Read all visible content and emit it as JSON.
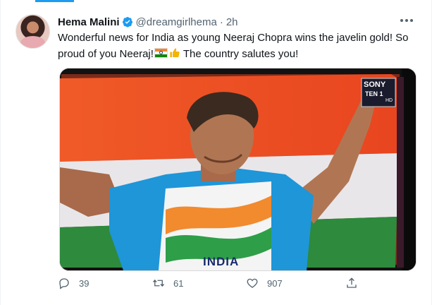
{
  "tweet": {
    "author_name": "Hema Malini",
    "handle": "@dreamgirlhema",
    "separator": "·",
    "time": "2h",
    "text_part1": "Wonderful news for India as young Neeraj Chopra wins the javelin gold! So proud of you Neeraj!",
    "text_part2": " The country salutes you!",
    "emojis": [
      "india-flag-icon",
      "thumbs-up-icon"
    ]
  },
  "media": {
    "broadcaster_logo": "SONY",
    "channel": "TEN 1",
    "hd_tag": "HD",
    "jersey_text": "INDIA"
  },
  "actions": {
    "reply_count": "39",
    "retweet_count": "61",
    "like_count": "907"
  },
  "colors": {
    "accent": "#1d9bf0",
    "muted": "#536471",
    "text": "#0f1419"
  }
}
